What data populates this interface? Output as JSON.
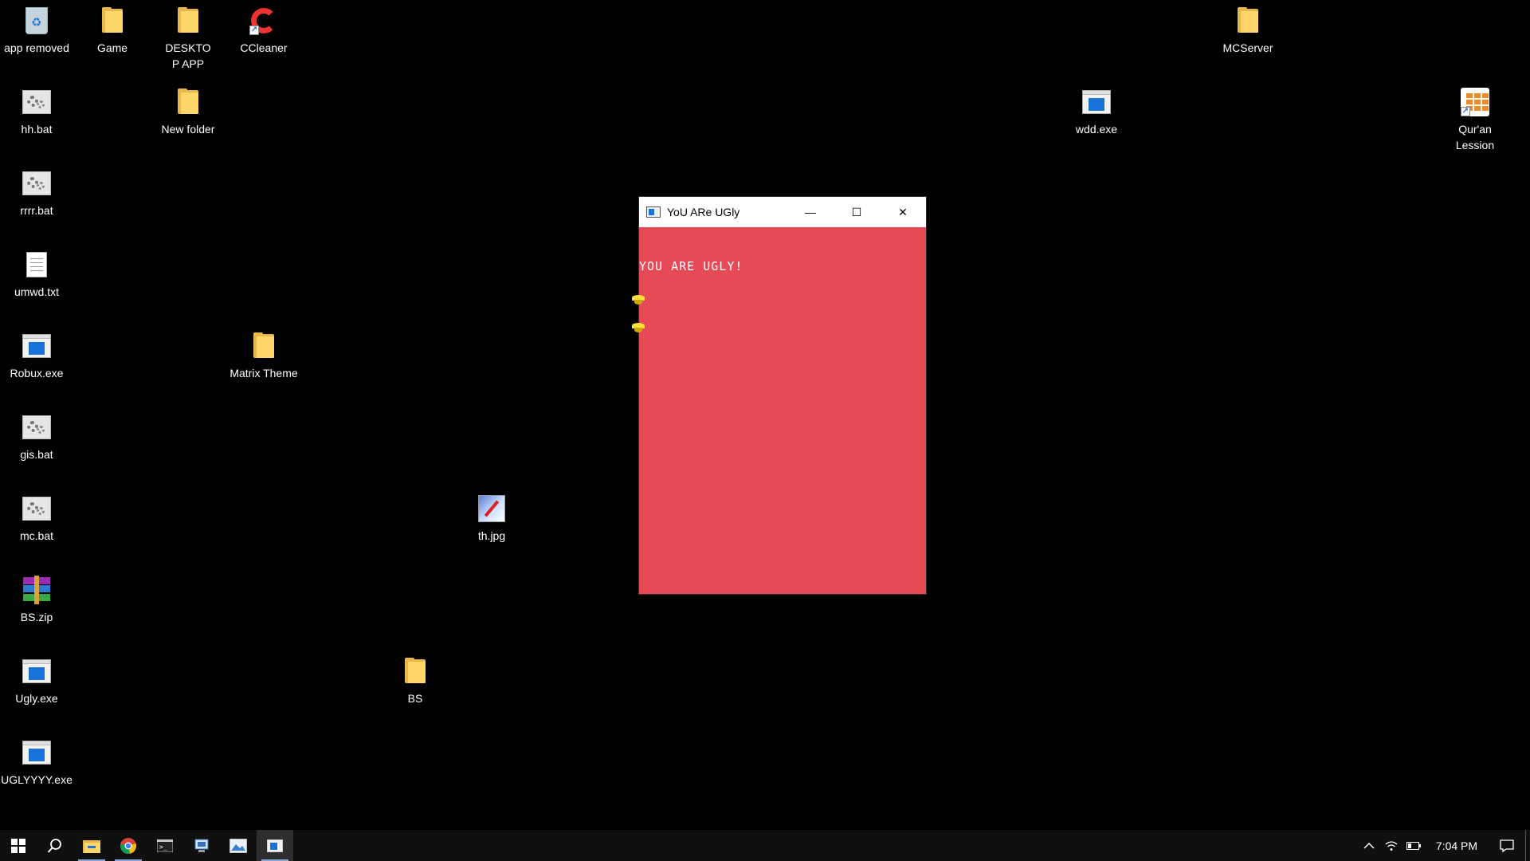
{
  "desktop": {
    "icons": [
      {
        "label": "app removed",
        "type": "recycle-bin"
      },
      {
        "label": "Game",
        "type": "folder"
      },
      {
        "label": "DESKTOP APP",
        "type": "folder"
      },
      {
        "label": "CCleaner",
        "type": "ccleaner-shortcut"
      },
      {
        "label": "MCServer",
        "type": "folder"
      },
      {
        "label": "hh.bat",
        "type": "bat"
      },
      {
        "label": "New folder",
        "type": "folder"
      },
      {
        "label": "wdd.exe",
        "type": "exe"
      },
      {
        "label": "Qur'an Lession",
        "type": "app-shortcut"
      },
      {
        "label": "rrrr.bat",
        "type": "bat"
      },
      {
        "label": "umwd.txt",
        "type": "txt"
      },
      {
        "label": "Robux.exe",
        "type": "exe"
      },
      {
        "label": "Matrix Theme",
        "type": "folder"
      },
      {
        "label": "gis.bat",
        "type": "bat"
      },
      {
        "label": "mc.bat",
        "type": "bat"
      },
      {
        "label": "th.jpg",
        "type": "jpg"
      },
      {
        "label": "BS.zip",
        "type": "zip"
      },
      {
        "label": "Ugly.exe",
        "type": "exe"
      },
      {
        "label": "BS",
        "type": "folder"
      },
      {
        "label": "UGLYYYY.exe",
        "type": "exe"
      }
    ]
  },
  "window": {
    "title": "YoU ARe UGly",
    "message": "YOU ARE UGLY!",
    "minimize_glyph": "—",
    "maximize_glyph": "☐",
    "close_glyph": "✕",
    "background_color": "#e64a57"
  },
  "taskbar": {
    "items": [
      "start",
      "search",
      "file-explorer",
      "chrome",
      "terminal",
      "network-tool",
      "photos",
      "ugly-app"
    ],
    "tray": {
      "clock": "7:04 PM",
      "icons": [
        "chevron-up-icon",
        "wifi-icon",
        "battery-icon",
        "notification-icon"
      ]
    }
  }
}
